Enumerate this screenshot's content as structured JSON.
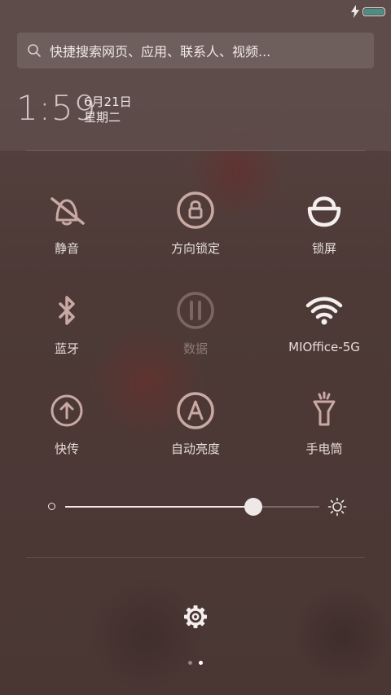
{
  "status_bar": {
    "charging_icon": "bolt-icon",
    "battery_icon": "battery-icon",
    "battery_level": 1.0,
    "battery_color": "#4a8f84"
  },
  "search": {
    "placeholder": "快捷搜索网页、应用、联系人、视频...",
    "icon": "search-icon"
  },
  "clock": {
    "time": "1:59",
    "date": "6月21日",
    "weekday": "星期二"
  },
  "tiles": [
    {
      "label": "静音",
      "icon": "mute-icon",
      "active": false
    },
    {
      "label": "方向锁定",
      "icon": "rotation-lock-icon",
      "active": false
    },
    {
      "label": "锁屏",
      "icon": "lock-screen-icon",
      "active": true
    },
    {
      "label": "蓝牙",
      "icon": "bluetooth-icon",
      "active": false
    },
    {
      "label": "数据",
      "icon": "mobile-data-icon",
      "active": false,
      "disabled": true
    },
    {
      "label": "MIOffice-5G",
      "icon": "wifi-icon",
      "active": true
    },
    {
      "label": "快传",
      "icon": "quick-transfer-icon",
      "active": false
    },
    {
      "label": "自动亮度",
      "icon": "auto-brightness-icon",
      "active": false
    },
    {
      "label": "手电筒",
      "icon": "flashlight-icon",
      "active": false
    }
  ],
  "brightness": {
    "level": 0.74,
    "min_icon": "brightness-low-icon",
    "max_icon": "brightness-high-icon"
  },
  "footer": {
    "settings_icon": "gear-icon",
    "page_count": 2,
    "active_page": 2
  },
  "colors": {
    "accent": "#efe8e6",
    "background": "#4a3734",
    "dim_text": "#8d7975"
  }
}
